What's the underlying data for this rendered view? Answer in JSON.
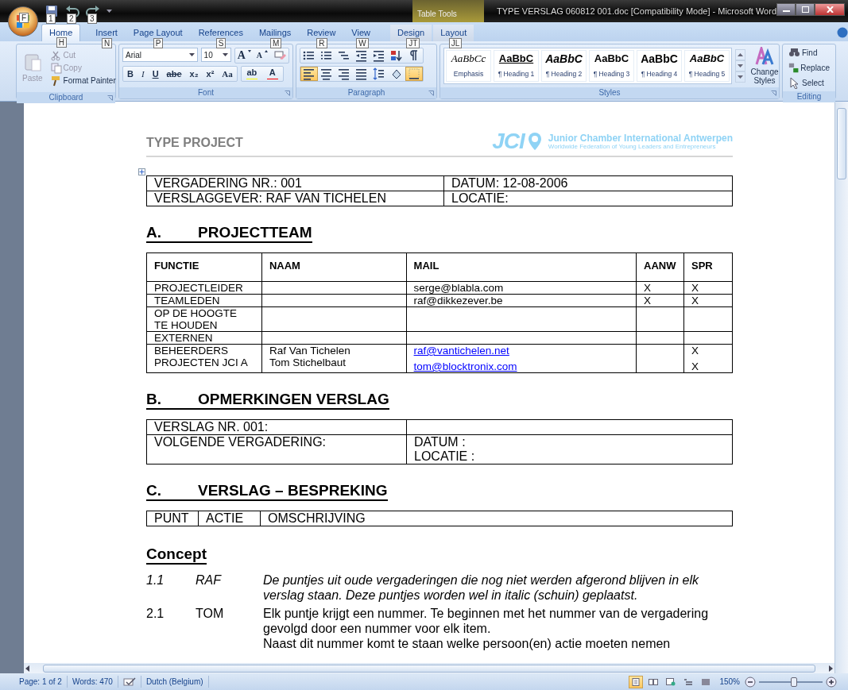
{
  "window": {
    "title": "TYPE VERSLAG 060812 001.doc [Compatibility Mode] - Microsoft Word",
    "office_keytip": "F",
    "contextual_label": "Table Tools"
  },
  "quick_access": [
    {
      "kind": "save",
      "keytip": "1"
    },
    {
      "kind": "undo",
      "keytip": "2"
    },
    {
      "kind": "redo",
      "keytip": "3"
    }
  ],
  "tabs": [
    {
      "label": "Home",
      "keytip": "H",
      "selected": true,
      "contextual": false
    },
    {
      "label": "Insert",
      "keytip": "N",
      "selected": false,
      "contextual": false
    },
    {
      "label": "Page Layout",
      "keytip": "P",
      "selected": false,
      "contextual": false
    },
    {
      "label": "References",
      "keytip": "S",
      "selected": false,
      "contextual": false
    },
    {
      "label": "Mailings",
      "keytip": "M",
      "selected": false,
      "contextual": false
    },
    {
      "label": "Review",
      "keytip": "R",
      "selected": false,
      "contextual": false
    },
    {
      "label": "View",
      "keytip": "W",
      "selected": false,
      "contextual": false
    },
    {
      "label": "Design",
      "keytip": "JT",
      "selected": false,
      "contextual": true
    },
    {
      "label": "Layout",
      "keytip": "JL",
      "selected": false,
      "contextual": true
    }
  ],
  "clipboard": {
    "label": "Clipboard",
    "paste": {
      "label": "Paste",
      "disabled": true
    },
    "cut": {
      "label": "Cut",
      "disabled": true
    },
    "copy": {
      "label": "Copy",
      "disabled": true
    },
    "format_painter": {
      "label": "Format Painter",
      "disabled": false
    }
  },
  "font": {
    "label": "Font",
    "name": "Arial",
    "size": "10",
    "row1": [
      {
        "kind": "grow",
        "label": "A"
      },
      {
        "kind": "shrink",
        "label": "A"
      },
      {
        "kind": "clear"
      }
    ],
    "row2": [
      {
        "kind": "bold",
        "label": "B"
      },
      {
        "kind": "italic",
        "label": "I"
      },
      {
        "kind": "underline",
        "label": "U"
      },
      {
        "kind": "strike",
        "label": "abe"
      },
      {
        "kind": "sub",
        "label": "x₂"
      },
      {
        "kind": "sup",
        "label": "x²"
      },
      {
        "kind": "case",
        "label": "Aa"
      }
    ],
    "highlight": {
      "label": "ab",
      "color": "#ffff00"
    },
    "font_color": {
      "label": "A",
      "color": "#ff0000"
    }
  },
  "paragraph": {
    "label": "Paragraph",
    "row1": [
      {
        "kind": "bullets",
        "selected": false
      },
      {
        "kind": "numbering",
        "selected": false
      },
      {
        "kind": "multilevel",
        "selected": false
      },
      {
        "kind": "outdent",
        "selected": false
      },
      {
        "kind": "indent",
        "selected": false
      },
      {
        "kind": "sort",
        "selected": false
      },
      {
        "kind": "pilcrow",
        "selected": false
      }
    ],
    "row2": [
      {
        "kind": "left",
        "selected": true
      },
      {
        "kind": "center",
        "selected": false
      },
      {
        "kind": "right",
        "selected": false
      },
      {
        "kind": "justify",
        "selected": false
      },
      {
        "kind": "spacing",
        "selected": false
      },
      {
        "kind": "shading",
        "selected": false
      },
      {
        "kind": "borders",
        "selected": true
      }
    ]
  },
  "styles": {
    "label": "Styles",
    "gallery": [
      {
        "kind": "emphasis",
        "preview": "AaBbCc",
        "name": "Emphasis"
      },
      {
        "kind": "h1",
        "preview": "AaBbC",
        "name": "¶ Heading 1"
      },
      {
        "kind": "h2",
        "preview": "AaBbC",
        "name": "¶ Heading 2"
      },
      {
        "kind": "h3",
        "preview": "AaBbC",
        "name": "¶ Heading 3"
      },
      {
        "kind": "h4",
        "preview": "AaBbC",
        "name": "¶ Heading 4"
      },
      {
        "kind": "h5",
        "preview": "AaBbC",
        "name": "¶ Heading 5"
      }
    ],
    "change_styles": "Change Styles"
  },
  "editing": {
    "label": "Editing",
    "find": "Find",
    "replace": "Replace",
    "select": "Select"
  },
  "document": {
    "header": {
      "title": "TYPE PROJECT",
      "logo_mark": "JCI",
      "org": "Junior Chamber International Antwerpen",
      "tagline": "Worldwide Federation of Young Leaders and Entrepreneurs"
    },
    "info_table": [
      [
        "VERGADERING NR.: 001",
        "DATUM: 12-08-2006"
      ],
      [
        "VERSLAGGEVER: RAF VAN TICHELEN",
        "LOCATIE:"
      ]
    ],
    "team": {
      "letter": "A.",
      "heading": "PROJECTTEAM",
      "columns": [
        "FUNCTIE",
        "NAAM",
        "MAIL",
        "AANW",
        "SPR"
      ],
      "rows": [
        {
          "functie": [
            "PROJECTLEIDER"
          ],
          "mail": [
            {
              "text": "serge@blabla.com",
              "link": false
            }
          ],
          "aanw": [
            "X"
          ],
          "spr": [
            "X"
          ]
        },
        {
          "functie": [
            "TEAMLEDEN"
          ],
          "mail": [
            {
              "text": "raf@dikkezever.be",
              "link": false
            }
          ],
          "aanw": [
            "X"
          ],
          "spr": [
            "X"
          ]
        },
        {
          "functie": [
            "OP DE HOOGTE",
            "TE HOUDEN"
          ]
        },
        {
          "functie": [
            "EXTERNEN"
          ]
        },
        {
          "functie": [
            "BEHEERDERS",
            "PROJECTEN JCI A"
          ],
          "naam": [
            "Raf Van Tichelen",
            "Tom Stichelbaut"
          ],
          "mail": [
            {
              "text": "raf@vantichelen.net",
              "link": true
            },
            {
              "text": "tom@blocktronix.com",
              "link": true
            }
          ],
          "spr": [
            "X",
            "X"
          ]
        }
      ]
    },
    "remarks": {
      "letter": "B.",
      "heading": "OPMERKINGEN VERSLAG",
      "rows": [
        {
          "label": "VERSLAG NR. 001:"
        },
        {
          "label": "VOLGENDE VERGADERING:",
          "values": [
            "DATUM :",
            "LOCATIE :"
          ]
        }
      ]
    },
    "discussion": {
      "letter": "C.",
      "heading": "VERSLAG – BESPREKING",
      "columns": [
        "PUNT",
        "ACTIE",
        "OMSCHRIJVING"
      ]
    },
    "concept": {
      "heading": "Concept",
      "items": [
        {
          "number": "1.1",
          "who": "RAF",
          "italic": true,
          "lines": [
            "De puntjes uit oude vergaderingen die nog niet werden afgerond blijven in elk verslag staan. Deze puntjes worden wel in italic (schuin) geplaatst."
          ]
        },
        {
          "number": "2.1",
          "who": "TOM",
          "italic": false,
          "lines": [
            "Elk puntje krijgt een nummer. Te beginnen met het nummer van de vergadering gevolgd door een nummer voor elk item.",
            "Naast dit nummer komt te staan welke persoon(en) actie moeten nemen"
          ]
        }
      ]
    }
  },
  "status_bar": {
    "page": "Page: 1 of 2",
    "words": "Words: 470",
    "language": "Dutch (Belgium)",
    "views": [
      {
        "kind": "print",
        "selected": true
      },
      {
        "kind": "reading",
        "selected": false
      },
      {
        "kind": "web",
        "selected": false
      },
      {
        "kind": "outline",
        "selected": false
      },
      {
        "kind": "draft",
        "selected": false
      }
    ],
    "zoom": "150%",
    "zoom_slider": {
      "level": 0.55
    }
  }
}
